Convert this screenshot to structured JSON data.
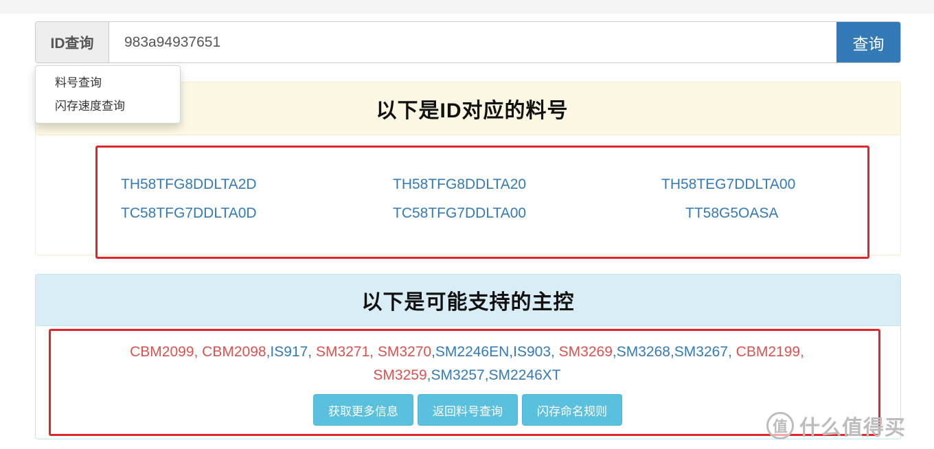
{
  "search": {
    "mode_label": "ID查询",
    "value": "983a94937651",
    "button_label": "查询"
  },
  "dropdown": {
    "items": [
      "料号查询",
      "闪存速度查询"
    ]
  },
  "panel_parts": {
    "title": "以下是ID对应的料号",
    "parts": [
      "TH58TFG8DDLTA2D",
      "TH58TFG8DDLTA20",
      "TH58TEG7DDLTA00",
      "TC58TFG7DDLTA0D",
      "TC58TFG7DDLTA00",
      "TT58G5OASA"
    ]
  },
  "panel_controllers": {
    "title": "以下是可能支持的主控",
    "controllers": [
      {
        "text": "CBM2099, ",
        "color": "red"
      },
      {
        "text": "CBM2098",
        "color": "red"
      },
      {
        "text": ",IS917, ",
        "color": "blue"
      },
      {
        "text": "SM3271, ",
        "color": "red"
      },
      {
        "text": "SM3270",
        "color": "red"
      },
      {
        "text": ",SM2246EN,IS903, ",
        "color": "blue"
      },
      {
        "text": "SM3269",
        "color": "red"
      },
      {
        "text": ",SM3268,SM3267, ",
        "color": "blue"
      },
      {
        "text": "CBM2199, ",
        "color": "red"
      },
      {
        "text": "SM3259",
        "color": "red"
      },
      {
        "text": ",SM3257,SM2246XT",
        "color": "blue"
      }
    ],
    "buttons": [
      "获取更多信息",
      "返回料号查询",
      "闪存命名规则"
    ]
  },
  "watermark": {
    "logo_char": "值",
    "text": "什么值得买"
  },
  "colors": {
    "primary": "#337ab7",
    "red_highlight": "#e0262b",
    "warning_bg": "#fcf8e3",
    "info_bg": "#d9edf7",
    "info_button": "#5bc0de",
    "controller_red": "#d9534f"
  }
}
